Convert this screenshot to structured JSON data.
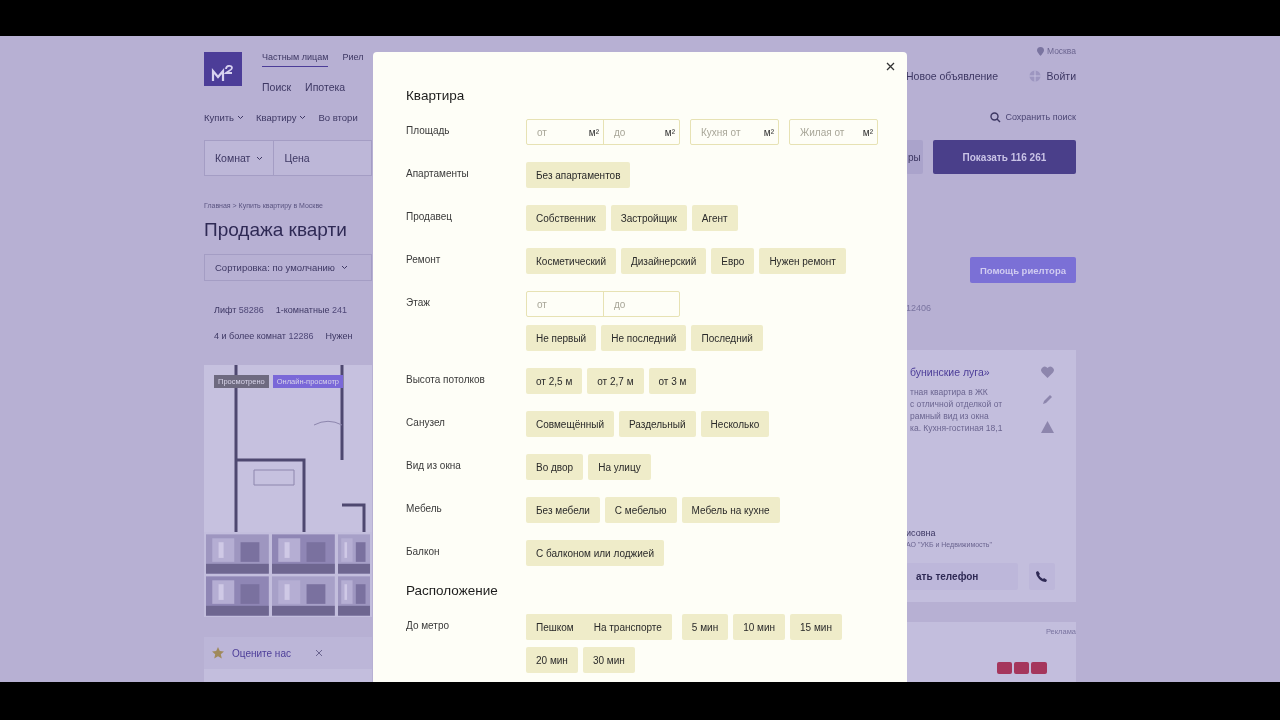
{
  "page": {
    "nav_tabs": [
      {
        "label": "Частным лицам",
        "selected": true
      },
      {
        "label": "Риел",
        "selected": false
      }
    ],
    "nav_links": [
      "Поиск",
      "Ипотека"
    ],
    "city": "Москва",
    "new_ad": "Новое объявление",
    "login": "Войти",
    "categories": [
      "Купить",
      "Квартиру",
      "Во втори"
    ],
    "rooms": "Комнат",
    "price": "Цена",
    "filters_button": "ры",
    "show_button": "Показать 116 261",
    "save_search": "Сохранить поиск",
    "breadcrumb": "Главная > Купить квартиру в Москве",
    "heading": "Продажа кварти",
    "sort": "Сортировка: по умолчанию",
    "realtor_button": "Помощь риелтора",
    "quick_filters": [
      [
        {
          "label": "Лифт",
          "count": "58286"
        },
        {
          "label": "1-комнатные",
          "count": "241"
        }
      ],
      [
        {
          "label": "4 и более комнат",
          "count": "12286"
        },
        {
          "label": "Нужен"
        }
      ]
    ],
    "right_count": "12406",
    "listing": {
      "badges": [
        {
          "label": "Просмотрено",
          "color": "#6e6a80"
        },
        {
          "label": "Онлайн-просмотр",
          "color": "#7a68d8"
        }
      ],
      "title": "бунинские луга»",
      "description": [
        "тная квартира в ЖК",
        "с отличной отделкой от",
        "рамный вид из окна",
        "ка. Кухня-гостиная 18,1"
      ],
      "agent": "исовна",
      "agency": "АО \"УКБ и Недвижимость\"",
      "phone_button": "ать телефон"
    },
    "rate_us": "Оцените нас",
    "ad_label": "Реклама"
  },
  "modal": {
    "sections": [
      {
        "title": "Квартира",
        "rows": [
          {
            "label": "Площадь",
            "kind": "range",
            "groups": [
              [
                {
                  "placeholder": "от",
                  "unit": "м²"
                },
                {
                  "placeholder": "до",
                  "unit": "м²"
                }
              ],
              [
                {
                  "placeholder": "Кухня от",
                  "unit": "м²"
                }
              ],
              [
                {
                  "placeholder": "Жилая от",
                  "unit": "м²"
                }
              ]
            ]
          },
          {
            "label": "Апартаменты",
            "kind": "chips",
            "chips": [
              "Без апартаментов"
            ]
          },
          {
            "label": "Продавец",
            "kind": "chips",
            "chips": [
              "Собственник",
              "Застройщик",
              "Агент"
            ]
          },
          {
            "label": "Ремонт",
            "kind": "chips",
            "chips": [
              "Косметический",
              "Дизайнерский",
              "Евро",
              "Нужен ремонт"
            ]
          },
          {
            "label": "Этаж",
            "kind": "range_chips",
            "groups": [
              [
                {
                  "placeholder": "от"
                },
                {
                  "placeholder": "до"
                }
              ]
            ],
            "chips": [
              "Не первый",
              "Не последний",
              "Последний"
            ]
          },
          {
            "label": "Высота потолков",
            "kind": "chips",
            "chips": [
              "от 2,5 м",
              "от 2,7 м",
              "от 3 м"
            ]
          },
          {
            "label": "Санузел",
            "kind": "chips",
            "chips": [
              "Совмещённый",
              "Раздельный",
              "Несколько"
            ]
          },
          {
            "label": "Вид из окна",
            "kind": "chips",
            "chips": [
              "Во двор",
              "На улицу"
            ]
          },
          {
            "label": "Мебель",
            "kind": "chips",
            "chips": [
              "Без мебели",
              "С мебелью",
              "Мебель на кухне"
            ]
          },
          {
            "label": "Балкон",
            "kind": "chips",
            "chips": [
              "С балконом или лоджией"
            ]
          }
        ]
      },
      {
        "title": "Расположение",
        "rows": [
          {
            "label": "До метро",
            "kind": "segmented_chips",
            "segments": [
              "Пешком",
              "На транспорте"
            ],
            "chips": [
              "5 мин",
              "10 мин",
              "15 мин",
              "20 мин",
              "30 мин"
            ]
          }
        ]
      }
    ]
  }
}
